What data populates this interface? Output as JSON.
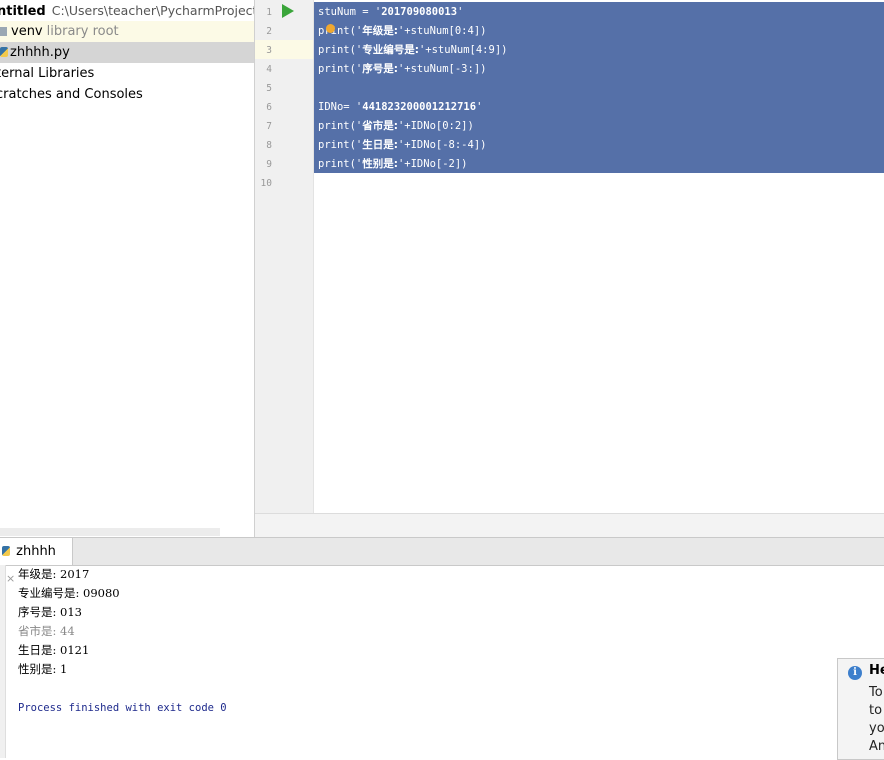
{
  "project": {
    "name": "ntitled",
    "path": "C:\\Users\\teacher\\PycharmProjects\\u",
    "venv": "venv",
    "venv_hint": "library root",
    "file": "zhhhh.py",
    "external_libraries": "ternal Libraries",
    "scratches": "cratches and Consoles"
  },
  "editor": {
    "line_numbers": [
      "1",
      "2",
      "3",
      "4",
      "5",
      "6",
      "7",
      "8",
      "9",
      "10"
    ],
    "lines": [
      {
        "a": "stuNum = '",
        "b": "201709080013",
        "c": "'"
      },
      {
        "a": "pr",
        "b": "int('",
        "c": "年级是:",
        "d": "'+stuNum[0:4])"
      },
      {
        "a": "print('",
        "c": "专业编号是:",
        "d": "'+stuNum[4:9])"
      },
      {
        "a": "print('",
        "c": "序号是:",
        "d": "'+stuNum[-3:])"
      },
      {},
      {
        "a": "IDNo= '",
        "b": "441823200001212716",
        "c": "'"
      },
      {
        "a": "print('",
        "c": "省市是:",
        "d": "'+IDNo[0:2])"
      },
      {
        "a": "print('",
        "c": "生日是:",
        "d": "'+IDNo[-8:-4])"
      },
      {
        "a": "print('",
        "c": "性别是:",
        "d": "'+IDNo[-2])"
      },
      {}
    ]
  },
  "run": {
    "tab_label": "zhhhh",
    "close": "×",
    "output": [
      "年级是: 2017",
      "专业编号是: 09080",
      "序号是: 013",
      "省市是: 44",
      "生日是: 0121",
      "性别是: 1"
    ],
    "exit_message": "Process finished with exit code 0"
  },
  "notification": {
    "icon": "info-icon",
    "title": "He",
    "lines": [
      "To",
      "to",
      "yo",
      "An"
    ]
  }
}
